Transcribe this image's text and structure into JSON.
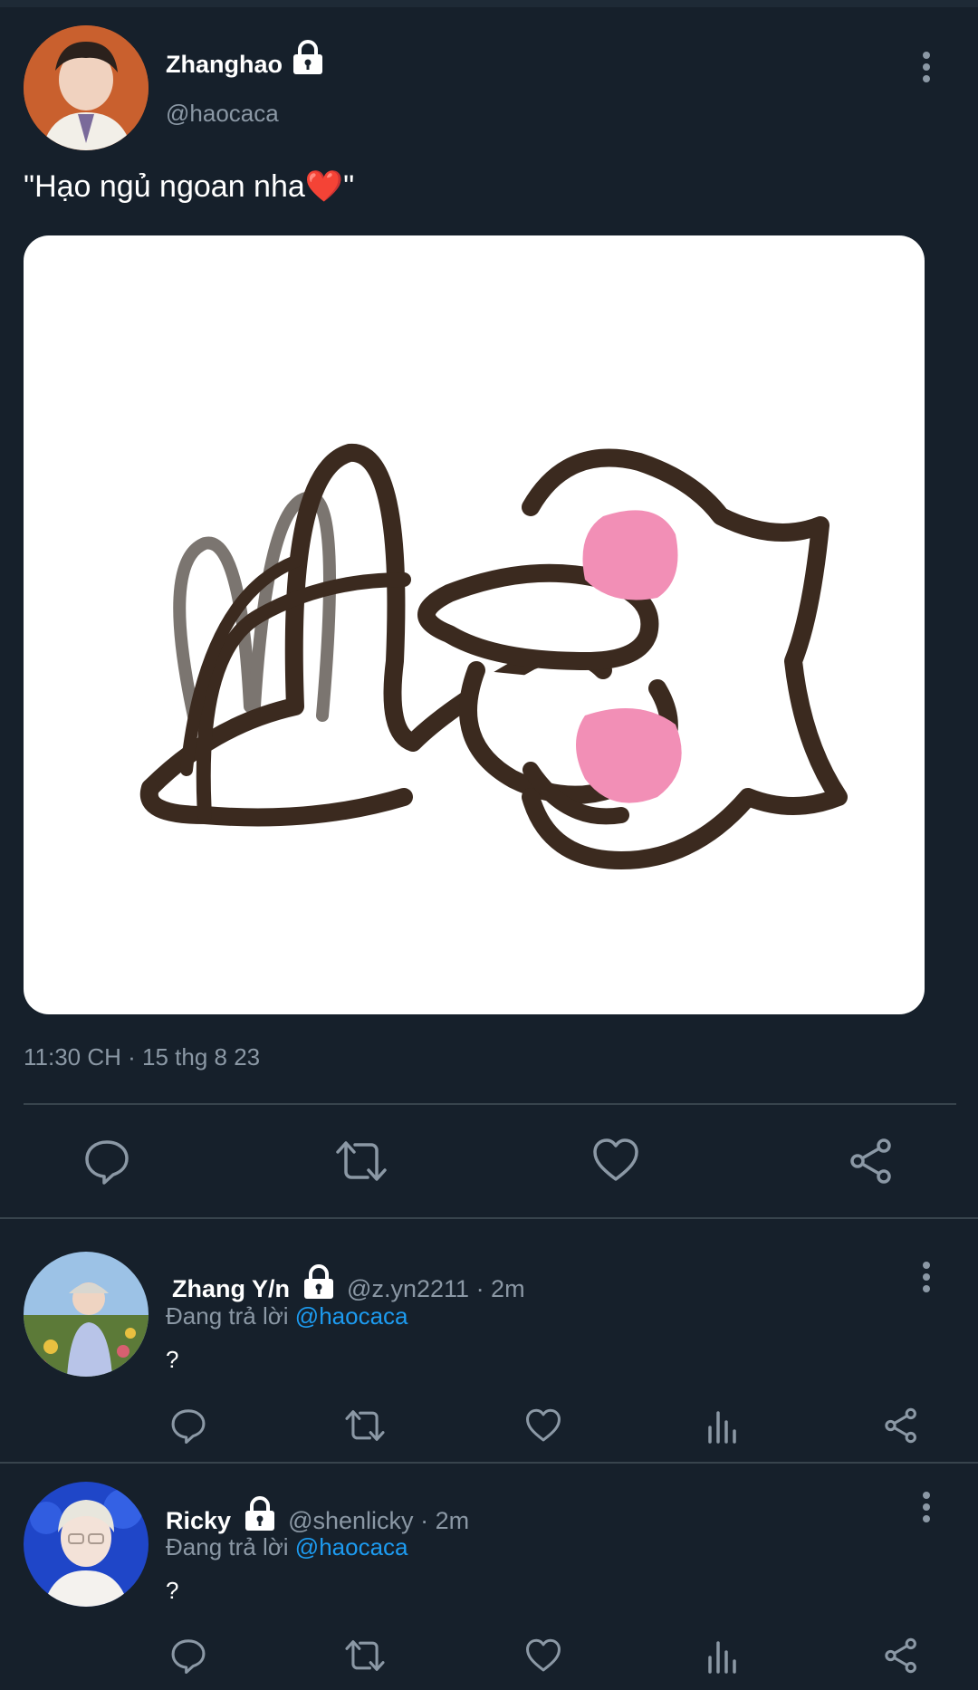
{
  "main_tweet": {
    "display_name": "Zhanghao",
    "handle": "@haocaca",
    "text": "\"Hạo ngủ ngoan nha❤️\"",
    "timestamp": "11:30 CH · 15 thg 8 23",
    "icons": [
      "more-vert-icon",
      "lock-icon",
      "reply-icon",
      "retweet-icon",
      "like-icon",
      "share-icon"
    ]
  },
  "replies": [
    {
      "display_name": "Zhang Y/n",
      "handle": "@z.yn2211",
      "time": "· 2m",
      "replying_prefix": "Đang trả lời",
      "replying_to": "@haocaca",
      "text": "?"
    },
    {
      "display_name": "Ricky",
      "handle": "@shenlicky",
      "time": "· 2m",
      "replying_prefix": "Đang trả lời",
      "replying_to": "@haocaca",
      "text": "?"
    }
  ],
  "colors": {
    "background": "#16202b",
    "divider": "#38444d",
    "muted": "#8b98a5",
    "link": "#1d9bf0",
    "heart": "#e0245e",
    "sticker_pink": "#f28fb6"
  }
}
